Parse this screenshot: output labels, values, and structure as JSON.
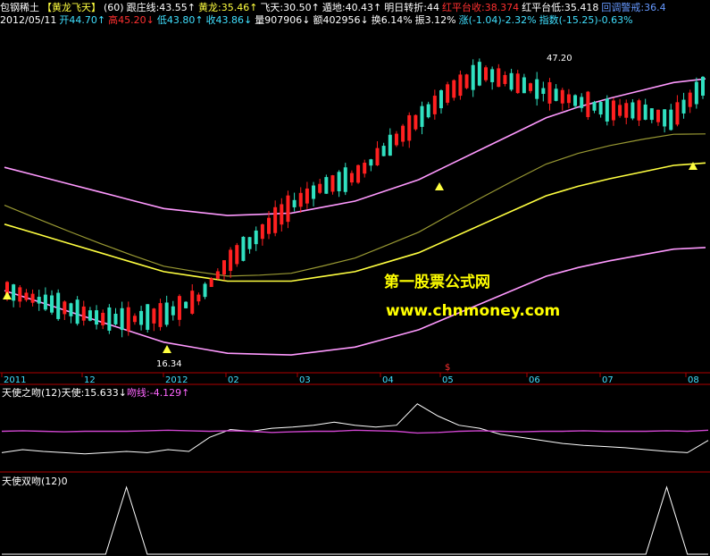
{
  "header": {
    "stock_name": "包钢稀土",
    "indicator_name": "【黄龙飞天】",
    "period": "(60)",
    "items": [
      {
        "label": "跟庄线:43.55↑",
        "color": "#ffffff"
      },
      {
        "label": "黄龙:35.46↑",
        "color": "#ffff40"
      },
      {
        "label": "飞天:30.50↑",
        "color": "#ffffff"
      },
      {
        "label": "遁地:40.43↑",
        "color": "#ffffff"
      },
      {
        "label": "明日转折:44",
        "color": "#ffffff"
      },
      {
        "label": "红平台收:38.374",
        "color": "#ff3030"
      },
      {
        "label": "红平台低:35.418",
        "color": "#ffffff"
      },
      {
        "label": "回调警戒:36.4",
        "color": "#6699ff"
      }
    ],
    "date": "2012/05/11",
    "quote": [
      {
        "label": "开44.70↑",
        "color": "#40e0ff"
      },
      {
        "label": "高45.20↓",
        "color": "#ff3030"
      },
      {
        "label": "低43.80↑",
        "color": "#40e0ff"
      },
      {
        "label": "收43.86↓",
        "color": "#40e0ff"
      },
      {
        "label": "量907906↓",
        "color": "#ffffff"
      },
      {
        "label": "额402956↓",
        "color": "#ffffff"
      },
      {
        "label": "换6.14%",
        "color": "#ffffff"
      },
      {
        "label": "振3.12%",
        "color": "#ffffff"
      },
      {
        "label": "涨(-1.04)-2.32%",
        "color": "#40e0ff"
      },
      {
        "label": "指数(-15.25)-0.63%",
        "color": "#40e0ff"
      }
    ]
  },
  "colors": {
    "up": "#ff2020",
    "down": "#30e0c0",
    "yellow_line": "#ffff40",
    "band": "#ff99ff",
    "olive_line": "#999933",
    "axis": "#b00000",
    "white_line": "#ffffff",
    "mag_line": "#cc44cc"
  },
  "chart_data": [
    {
      "type": "line",
      "panel": "main",
      "x_ticks": [
        "2011",
        "12",
        "2012",
        "02",
        "03",
        "04",
        "05",
        "06",
        "07",
        "08"
      ],
      "annotations": [
        "47.20",
        "16.34",
        "$"
      ],
      "series": [
        {
          "name": "黄龙",
          "values": [
            29,
            28,
            27,
            26,
            25,
            24,
            23.5,
            23,
            23,
            23,
            23.5,
            24,
            25,
            26,
            27.5,
            29,
            30.5,
            32,
            33,
            33.8,
            34.5,
            35.2,
            35.46
          ]
        },
        {
          "name": "跟庄线",
          "values": [
            22,
            21,
            20,
            19,
            19,
            19.5,
            21,
            25,
            28,
            31,
            33,
            34,
            37,
            40,
            43,
            45,
            44,
            43,
            42,
            41,
            41,
            40,
            43.55
          ]
        },
        {
          "name": "飞天",
          "values": [
            18,
            17,
            16,
            15.5,
            16,
            17,
            19,
            22,
            24,
            25,
            26,
            27,
            28,
            29,
            30,
            31,
            31,
            30,
            29,
            29,
            29,
            29,
            30.5
          ]
        },
        {
          "name": "遁地",
          "values": [
            34,
            33,
            32,
            31.5,
            31,
            31,
            31.5,
            33,
            35,
            37,
            38,
            39,
            40,
            41,
            42,
            43,
            44,
            44.5,
            44.8,
            44.9,
            44.9,
            44.9,
            40.43
          ]
        }
      ],
      "ylim": [
        14,
        50
      ]
    },
    {
      "type": "line",
      "panel": "tianshi_zhiwen",
      "title": "天使之吻(12)",
      "series": [
        {
          "name": "天使",
          "label": "天使:15.633↓",
          "values": [
            0.1,
            0.15,
            0.12,
            0.1,
            0.08,
            0.1,
            0.12,
            0.1,
            0.15,
            0.12,
            0.35,
            0.48,
            0.45,
            0.5,
            0.52,
            0.55,
            0.6,
            0.55,
            0.52,
            0.55,
            0.9,
            0.7,
            0.55,
            0.5,
            0.4,
            0.35,
            0.3,
            0.25,
            0.22,
            0.2,
            0.18,
            0.15,
            0.12,
            0.1,
            0.3
          ]
        },
        {
          "name": "吻线",
          "label": "吻线:-4.129↑",
          "values": [
            0,
            0.01,
            0,
            -0.01,
            0,
            0,
            0,
            0.01,
            0.02,
            0.01,
            0,
            0.01,
            0,
            -0.02,
            -0.01,
            0,
            0,
            0.02,
            0.01,
            0,
            -0.03,
            -0.02,
            0,
            0.01,
            0,
            -0.01,
            0,
            0,
            0.01,
            0,
            0,
            0,
            0.01,
            0,
            0.02
          ]
        }
      ]
    },
    {
      "type": "line",
      "panel": "tianshi_shuangwen",
      "title": "天使双吻(12)",
      "value_label": "0",
      "series": [
        {
          "name": "天使双吻",
          "values": [
            0,
            0,
            0,
            0,
            0,
            0,
            1,
            0,
            0,
            0,
            0,
            0,
            0,
            0,
            0,
            0,
            0,
            0,
            0,
            0,
            0,
            0,
            0,
            0,
            0,
            0,
            0,
            0,
            0,
            0,
            0,
            0,
            1,
            0,
            0
          ]
        }
      ]
    }
  ],
  "watermark": {
    "line1": "第一股票公式网",
    "line2": "www.chnmoney.com"
  }
}
